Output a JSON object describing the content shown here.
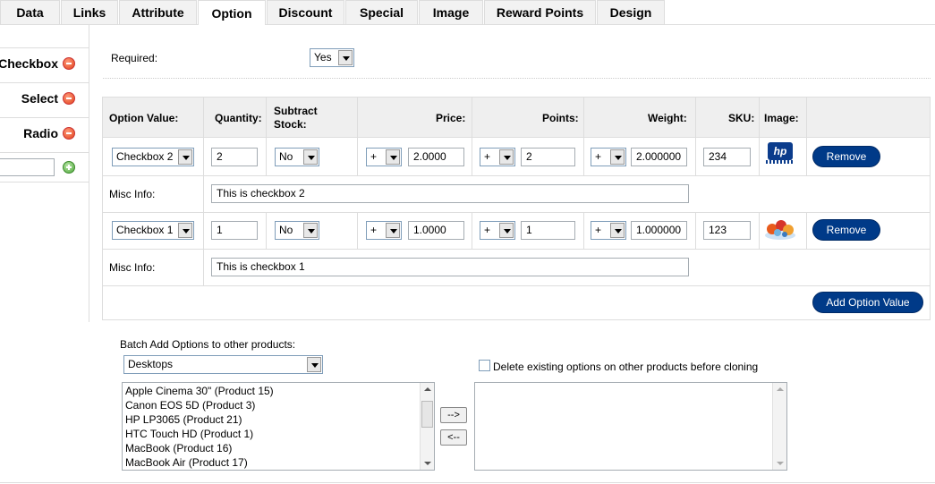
{
  "tabs": [
    "Data",
    "Links",
    "Attribute",
    "Option",
    "Discount",
    "Special",
    "Image",
    "Reward Points",
    "Design"
  ],
  "active_tab": "Option",
  "option_list": {
    "items": [
      "Checkbox",
      "Select",
      "Radio"
    ],
    "add_input_value": ""
  },
  "required": {
    "label": "Required:",
    "value": "Yes"
  },
  "option_values": {
    "headers": {
      "option_value": "Option Value:",
      "quantity": "Quantity:",
      "subtract_line1": "Subtract",
      "subtract_line2": "Stock:",
      "price": "Price:",
      "points": "Points:",
      "weight": "Weight:",
      "sku": "SKU:",
      "image": "Image:"
    },
    "rows": [
      {
        "option_value": "Checkbox 2",
        "quantity": "2",
        "subtract": "No",
        "price_prefix": "+",
        "price": "2.0000",
        "points_prefix": "+",
        "points": "2",
        "weight_prefix": "+",
        "weight": "2.000000",
        "sku": "234",
        "image_icon": "hp-logo-thumbnail",
        "misc_label": "Misc Info:",
        "misc_value": "This is checkbox 2",
        "remove_label": "Remove"
      },
      {
        "option_value": "Checkbox 1",
        "quantity": "1",
        "subtract": "No",
        "price_prefix": "+",
        "price": "1.0000",
        "points_prefix": "+",
        "points": "1",
        "weight_prefix": "+",
        "weight": "1.000000",
        "sku": "123",
        "image_icon": "fruit-thumbnail",
        "misc_label": "Misc Info:",
        "misc_value": "This is checkbox 1",
        "remove_label": "Remove"
      }
    ],
    "add_button": "Add Option Value"
  },
  "batch": {
    "label": "Batch Add Options to other products:",
    "category": "Desktops",
    "products": [
      "Apple Cinema 30\" (Product 15)",
      "Canon EOS 5D (Product 3)",
      "HP LP3065 (Product 21)",
      "HTC Touch HD (Product 1)",
      "MacBook (Product 16)",
      "MacBook Air (Product 17)"
    ],
    "add_button": "-->",
    "remove_button": "<--",
    "delete_checkbox_label": "Delete existing options on other products before cloning",
    "delete_checked": false
  }
}
